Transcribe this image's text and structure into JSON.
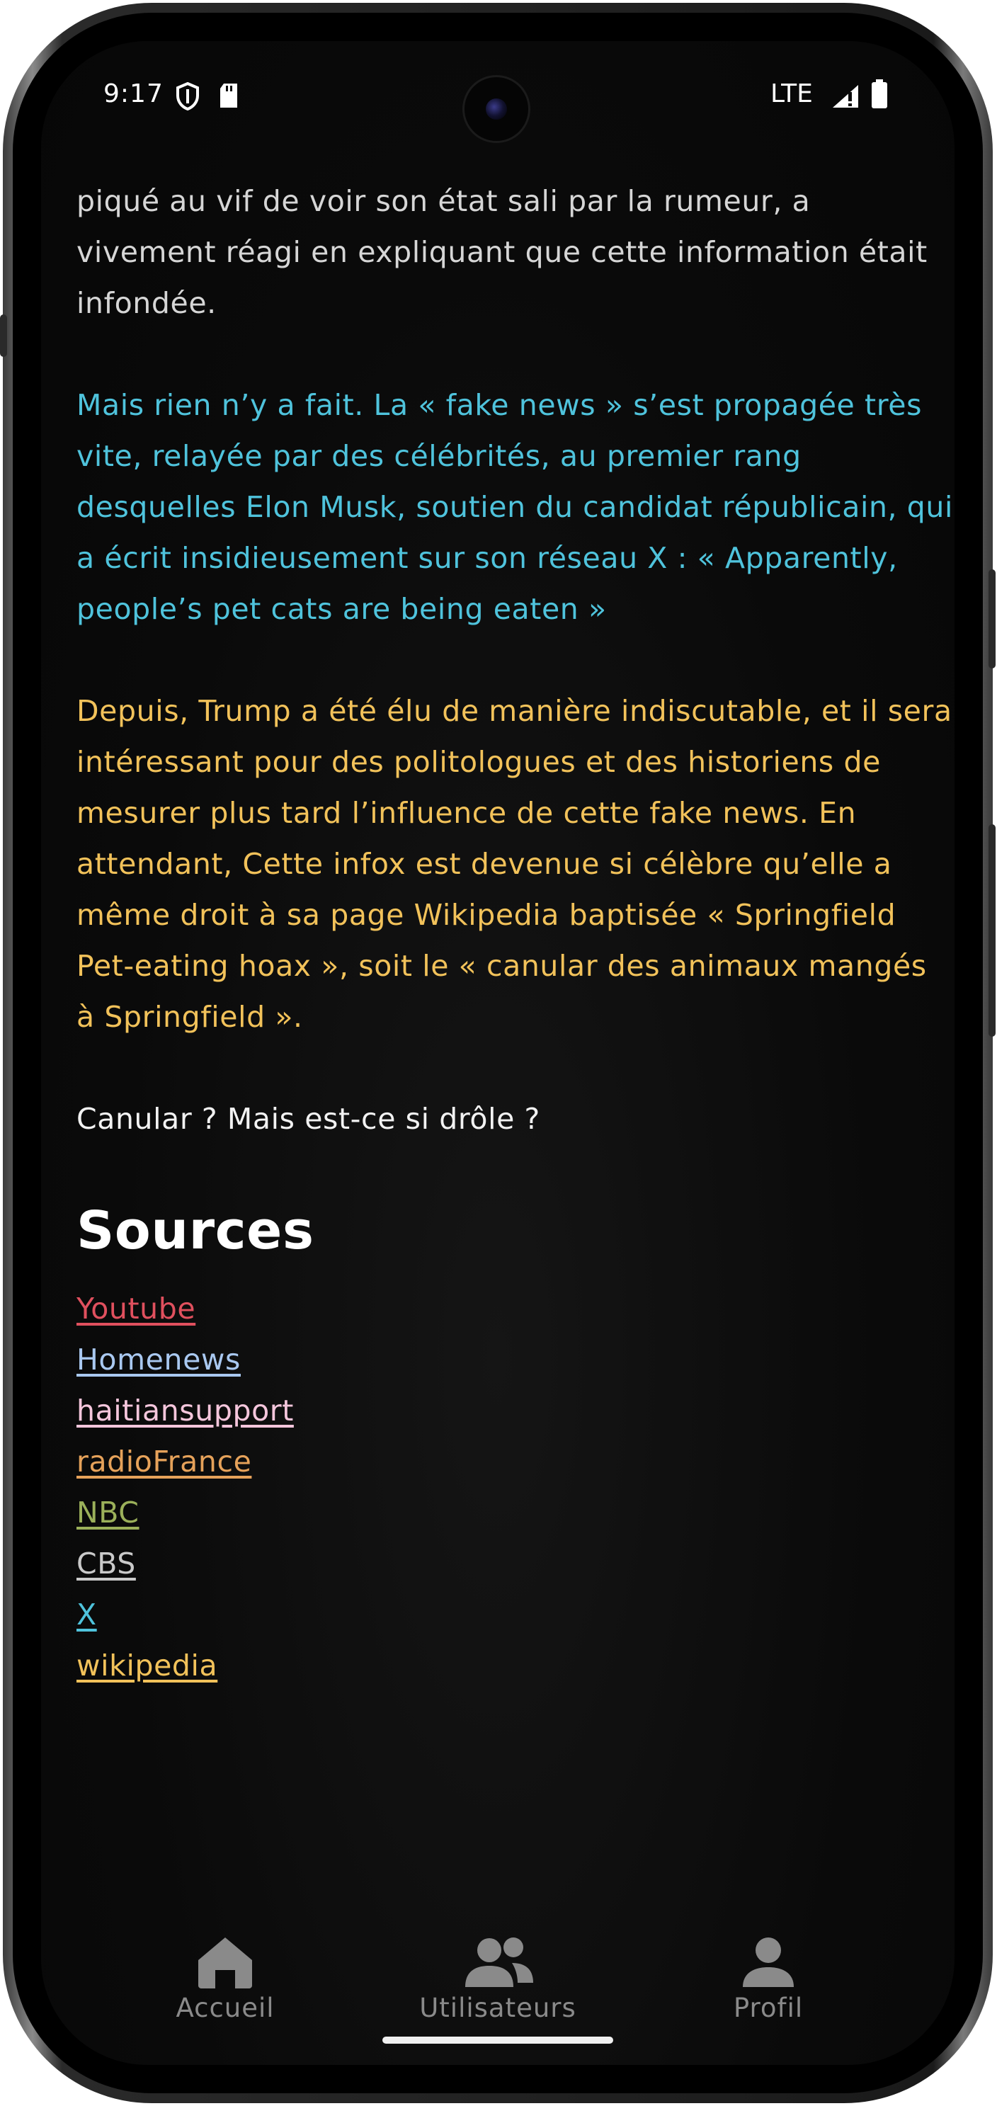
{
  "status_bar": {
    "time": "9:17",
    "network": "LTE",
    "icons": [
      "shield-icon",
      "sd-card-icon",
      "signal-icon",
      "battery-icon"
    ]
  },
  "article": {
    "paragraph_1": "piqué au vif de voir son état sali par la rumeur, a vivement réagi en expliquant que cette information était infondée.",
    "paragraph_2": "Mais rien n’y a fait. La « fake news » s’est propagée très vite, relayée par des célébrités, au premier rang desquelles Elon Musk, soutien du candidat républicain, qui a écrit insidieusement sur son réseau X : « Apparently, people’s pet cats are being eaten »",
    "paragraph_3": "Depuis, Trump a été élu de manière indiscutable, et il sera intéressant pour des politologues et des historiens de mesurer plus tard l’influence de cette fake news. En attendant, Cette infox est devenue si célèbre qu’elle a même droit à sa page Wikipedia baptisée « Springfield Pet-eating hoax », soit le « canular des animaux mangés à Springfield ».",
    "paragraph_4": "Canular ? Mais est-ce si drôle ?",
    "colors": {
      "paragraph_1": "#d6d6d6",
      "paragraph_2": "#4fc3dc",
      "paragraph_3": "#f2c25a",
      "paragraph_4": "#f2f2f2"
    }
  },
  "sources": {
    "title": "Sources",
    "links": [
      {
        "label": "Youtube",
        "color": "#e0505e"
      },
      {
        "label": "Homenews",
        "color": "#a9c8f0"
      },
      {
        "label": "haitiansupport",
        "color": "#f5c6dc"
      },
      {
        "label": "radioFrance",
        "color": "#e6a25a"
      },
      {
        "label": "NBC",
        "color": "#9bb05a"
      },
      {
        "label": "CBS",
        "color": "#c9c9c9"
      },
      {
        "label": "X",
        "color": "#4fc3dc"
      },
      {
        "label": "wikipedia",
        "color": "#f2c25a"
      }
    ]
  },
  "bottom_nav": {
    "items": [
      {
        "label": "Accueil",
        "icon": "home-icon"
      },
      {
        "label": "Utilisateurs",
        "icon": "users-icon"
      },
      {
        "label": "Profil",
        "icon": "user-icon"
      }
    ]
  }
}
